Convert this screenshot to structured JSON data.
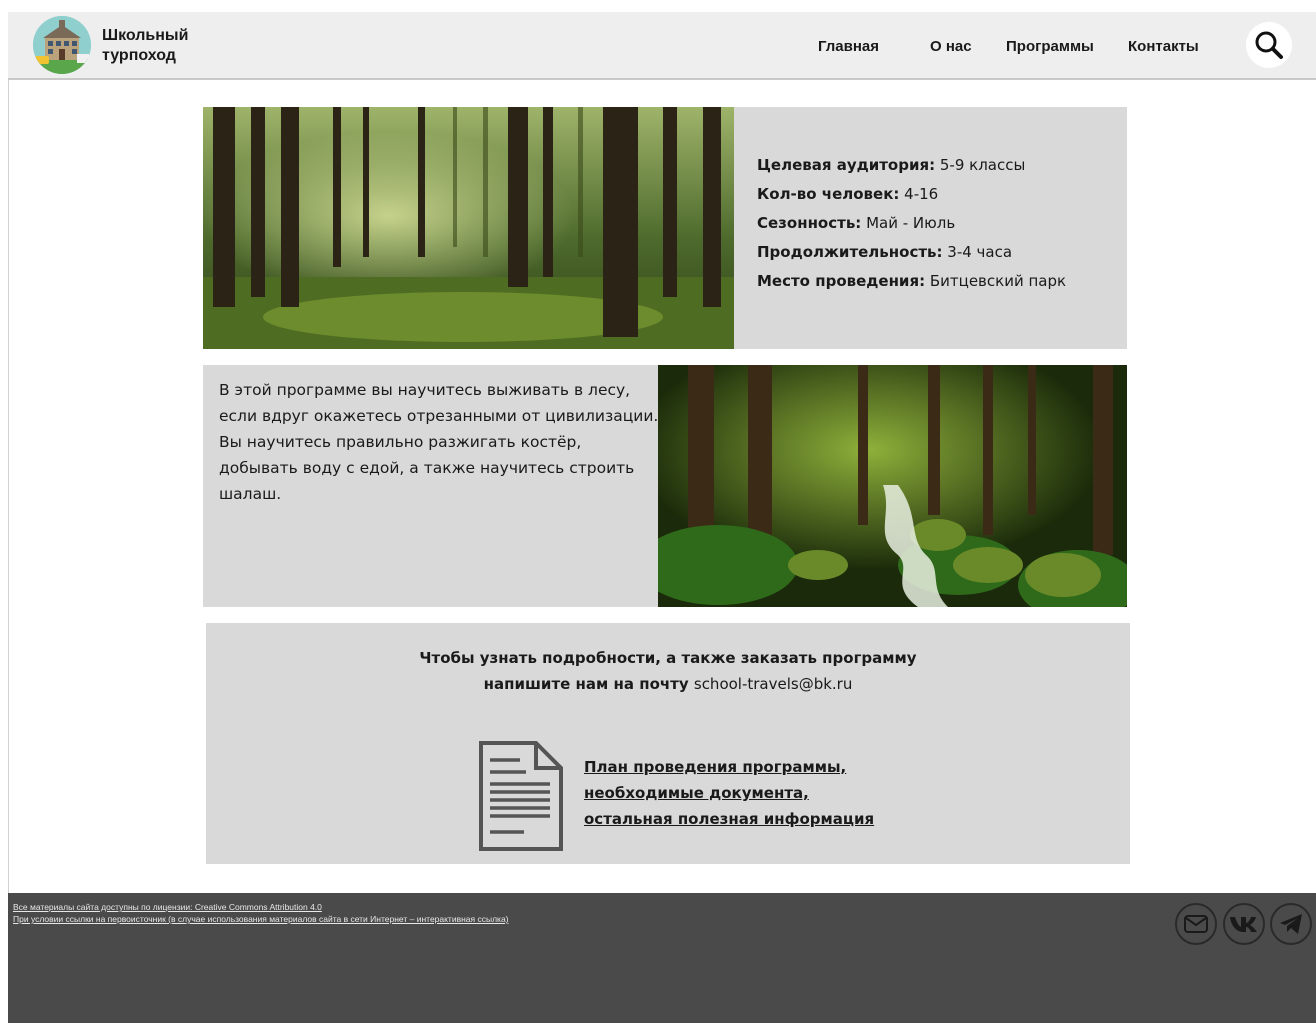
{
  "header": {
    "brand_line1": "Школьный",
    "brand_line2": "турпоход",
    "nav": [
      "Главная",
      "О нас",
      "Программы",
      "Контакты"
    ]
  },
  "program_info": [
    {
      "label": "Целевая аудитория:",
      "value": " 5-9 классы"
    },
    {
      "label": "Кол-во человек:",
      "value": " 4-16"
    },
    {
      "label": "Сезонность:",
      "value": " Май - Июль"
    },
    {
      "label": "Продолжительность:",
      "value": " 3-4 часа"
    },
    {
      "label": "Место проведения:",
      "value": " Битцевский парк"
    }
  ],
  "description": [
    "В этой программе вы научитесь выживать в лесу,",
    "если вдруг окажетесь отрезанными от цивилизации.",
    "Вы научитесь правильно разжигать костёр,",
    "добывать воду с едой, а также научитесь строить",
    "шалаш."
  ],
  "contact": {
    "line1": "Чтобы узнать подробности, а также заказать программу",
    "line2": "напишите нам на почту ",
    "email": "school-travels@bk.ru"
  },
  "documents": [
    "План проведения программы,",
    "необходимые документа,",
    "остальная полезная информация"
  ],
  "footer": {
    "line1": "Все материалы сайта доступны по лицензии: Creative Commons Attribution 4.0",
    "line2": "При условии ссылки на первоисточник (в случае использования материалов сайта в сети Интернет – интерактивная ссылка)"
  },
  "social": [
    "mail-icon",
    "vk-icon",
    "telegram-icon"
  ],
  "colors": {
    "header_bg": "#eeeeee",
    "panel_bg": "#d9d9d9",
    "footer_bg": "#4a4a4a"
  }
}
